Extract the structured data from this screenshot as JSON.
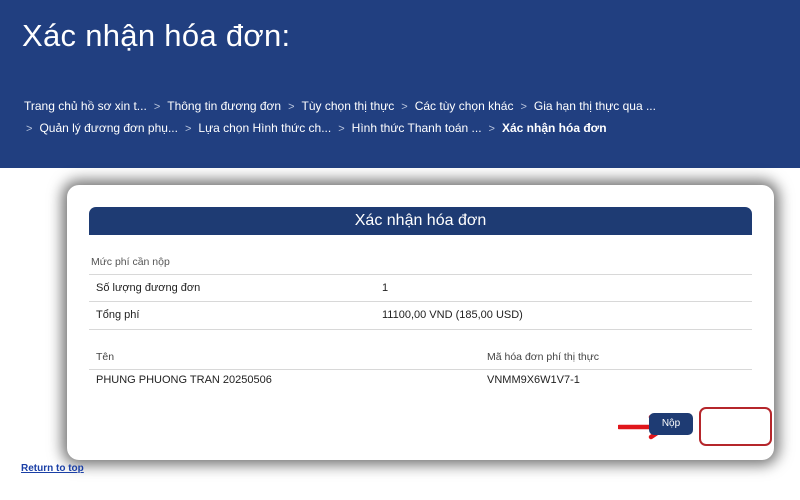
{
  "header": {
    "title": "Xác nhận hóa đơn:",
    "breadcrumb_row1": [
      "Trang chủ hồ sơ xin t...",
      "Thông tin đương đơn",
      "Tùy chọn thị thực",
      "Các tùy chọn khác",
      "Gia hạn thị thực qua ..."
    ],
    "breadcrumb_row2": [
      "Quản lý đương đơn phụ...",
      "Lựa chọn Hình thức ch...",
      "Hình thức Thanh toán ...",
      "Xác nhận hóa đơn"
    ],
    "separator": ">"
  },
  "modal": {
    "title": "Xác nhận hóa đơn",
    "fee_section_label": "Mức phí cần nộp",
    "fees": [
      {
        "label": "Số lượng đương đơn",
        "value": "1"
      },
      {
        "label": "Tổng phí",
        "value": "11100,00 VND (185,00 USD)"
      }
    ],
    "invoice_columns": [
      "Tên",
      "Mã hóa đơn phí thị thực"
    ],
    "invoice_rows": [
      [
        "PHUNG PHUONG TRAN 20250506",
        "VNMM9X6W1V7-1"
      ]
    ],
    "submit_label": "Nộp"
  },
  "footer": {
    "return_link": "Return to top"
  },
  "colors": {
    "header_bg": "#213f80",
    "modal_header_bg": "#1e3b73",
    "annotation_red": "#e0161b",
    "highlight_border": "#b5262b",
    "link": "#1a3fa6"
  },
  "icons": {
    "annotation": "right-arrow-icon"
  }
}
